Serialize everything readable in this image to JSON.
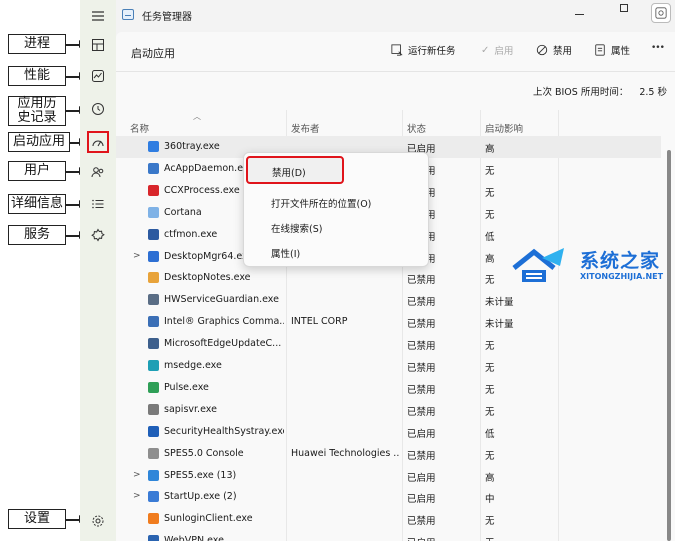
{
  "annotations": [
    {
      "key": "processes",
      "label": "进程"
    },
    {
      "key": "performance",
      "label": "性能"
    },
    {
      "key": "app_history",
      "label": "应用历史记录"
    },
    {
      "key": "startup",
      "label": "启动应用"
    },
    {
      "key": "users",
      "label": "用户"
    },
    {
      "key": "details",
      "label": "详细信息"
    },
    {
      "key": "services",
      "label": "服务"
    },
    {
      "key": "settings",
      "label": "设置"
    }
  ],
  "window": {
    "title": "任务管理器"
  },
  "page": {
    "title": "启动应用"
  },
  "toolbar": {
    "run_new_task": "运行新任务",
    "enable": "启用",
    "disable": "禁用",
    "properties": "属性",
    "more": "•••"
  },
  "bios": {
    "label": "上次 BIOS 所用时间：",
    "value": "2.5 秒"
  },
  "columns": {
    "name": "名称",
    "publisher": "发布者",
    "status": "状态",
    "impact": "启动影响"
  },
  "rows": [
    {
      "name": "360tray.exe",
      "publisher": "",
      "status": "已启用",
      "impact": "高",
      "expand": "",
      "icon_color": "#2f7de1"
    },
    {
      "name": "AcAppDaemon.exe",
      "publisher": "",
      "status": "已启用",
      "impact": "无",
      "expand": "",
      "icon_color": "#3a78c9"
    },
    {
      "name": "CCXProcess.exe",
      "publisher": "",
      "status": "已启用",
      "impact": "无",
      "expand": "",
      "icon_color": "#d8262b"
    },
    {
      "name": "Cortana",
      "publisher": "",
      "status": "已启用",
      "impact": "无",
      "expand": "",
      "icon_color": "#7fb2e6"
    },
    {
      "name": "ctfmon.exe",
      "publisher": "",
      "status": "已启用",
      "impact": "低",
      "expand": "",
      "icon_color": "#2c5aa0"
    },
    {
      "name": "DesktopMgr64.exe",
      "publisher": "",
      "status": "已启用",
      "impact": "高",
      "expand": ">",
      "icon_color": "#2d6fd3"
    },
    {
      "name": "DesktopNotes.exe",
      "publisher": "",
      "status": "已禁用",
      "impact": "无",
      "expand": "",
      "icon_color": "#e8a33a"
    },
    {
      "name": "HWServiceGuardian.exe",
      "publisher": "",
      "status": "已禁用",
      "impact": "未计量",
      "expand": "",
      "icon_color": "#5a6d85"
    },
    {
      "name": "Intel® Graphics Comma...",
      "publisher": "INTEL CORP",
      "status": "已禁用",
      "impact": "未计量",
      "expand": "",
      "icon_color": "#3b6fb6"
    },
    {
      "name": "MicrosoftEdgeUpdateC...",
      "publisher": "",
      "status": "已禁用",
      "impact": "无",
      "expand": "",
      "icon_color": "#3d5f8c"
    },
    {
      "name": "msedge.exe",
      "publisher": "",
      "status": "已禁用",
      "impact": "无",
      "expand": "",
      "icon_color": "#1e9fb5"
    },
    {
      "name": "Pulse.exe",
      "publisher": "",
      "status": "已禁用",
      "impact": "无",
      "expand": "",
      "icon_color": "#2f9f57"
    },
    {
      "name": "sapisvr.exe",
      "publisher": "",
      "status": "已禁用",
      "impact": "无",
      "expand": "",
      "icon_color": "#7a7a7a"
    },
    {
      "name": "SecurityHealthSystray.exe",
      "publisher": "",
      "status": "已启用",
      "impact": "低",
      "expand": "",
      "icon_color": "#1f5fb8"
    },
    {
      "name": "SPES5.0 Console",
      "publisher": "Huawei Technologies ...",
      "status": "已禁用",
      "impact": "无",
      "expand": "",
      "icon_color": "#8e8e8e"
    },
    {
      "name": "SPES5.exe (13)",
      "publisher": "",
      "status": "已启用",
      "impact": "高",
      "expand": ">",
      "icon_color": "#2f86d9"
    },
    {
      "name": "StartUp.exe (2)",
      "publisher": "",
      "status": "已启用",
      "impact": "中",
      "expand": ">",
      "icon_color": "#3a7bd5"
    },
    {
      "name": "SunloginClient.exe",
      "publisher": "",
      "status": "已禁用",
      "impact": "无",
      "expand": "",
      "icon_color": "#f07c1e"
    },
    {
      "name": "WebVPN.exe",
      "publisher": "",
      "status": "已启用",
      "impact": "无",
      "expand": "",
      "icon_color": "#2a63b0"
    }
  ],
  "context_menu": {
    "disable": "禁用(D)",
    "open_location": "打开文件所在的位置(O)",
    "search_online": "在线搜索(S)",
    "properties": "属性(I)"
  },
  "watermark": {
    "brand": "系统之家",
    "url": "XITONGZHIJIA.NET"
  },
  "colors": {
    "highlight": "#e0141b",
    "sidebar": "#eef2e9",
    "content": "#f9f9f9"
  }
}
